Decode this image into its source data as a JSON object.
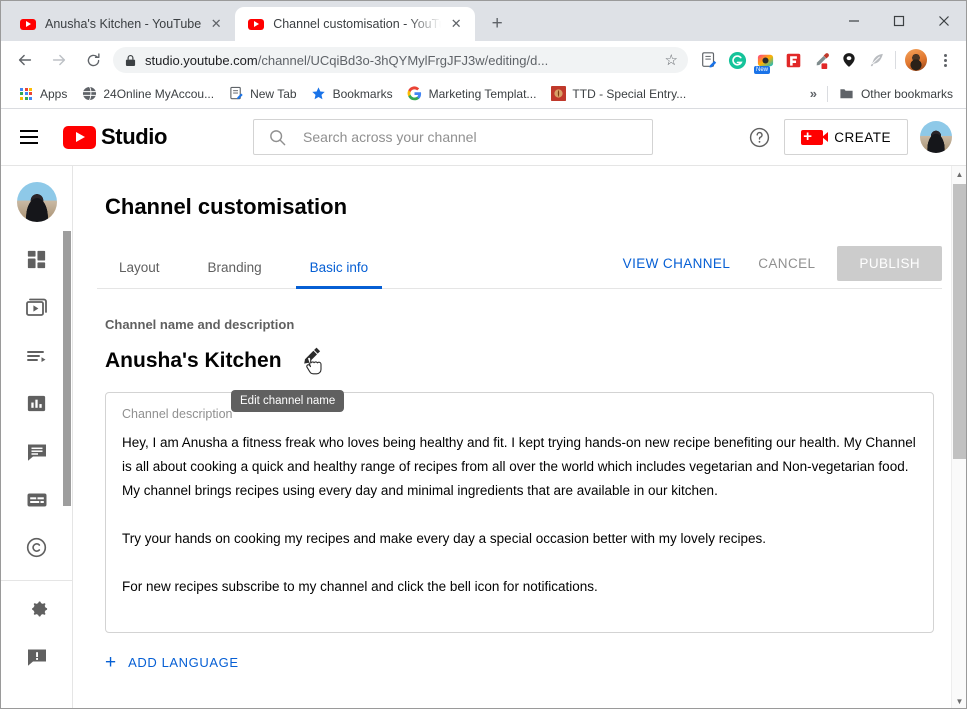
{
  "browser": {
    "tabs": [
      {
        "title": "Anusha's Kitchen - YouTube",
        "favicon": "youtube-icon",
        "active": false
      },
      {
        "title": "Channel customisation - YouTube Studio",
        "favicon": "youtube-icon",
        "active": true
      }
    ],
    "new_tab_label": "+",
    "window_controls": {
      "minimize": "minimize-icon",
      "maximize": "maximize-icon",
      "close": "close-icon"
    },
    "nav": {
      "back": "back-arrow-icon",
      "forward": "forward-arrow-icon",
      "reload": "reload-icon"
    },
    "omnibox": {
      "lock": "lock-icon",
      "url_domain": "studio.youtube.com",
      "url_path": "/channel/UCqiBd3o-3hQYMylFrgJFJ3w/editing/d...",
      "bookmark_star": "star-icon"
    },
    "extensions": [
      {
        "name": "note-edit-extension-icon"
      },
      {
        "name": "grammarly-extension-icon"
      },
      {
        "name": "screenshot-extension-icon",
        "badge": "New"
      },
      {
        "name": "flipboard-extension-icon"
      },
      {
        "name": "eyedropper-extension-icon"
      },
      {
        "name": "location-pin-extension-icon"
      },
      {
        "name": "feather-extension-icon"
      }
    ],
    "profile_avatar": "profile-avatar",
    "menu": "kebab-menu-icon",
    "bookmarks": [
      {
        "label": "Apps",
        "icon": "apps-grid-icon"
      },
      {
        "label": "24Online MyAccou...",
        "icon": "globe-icon"
      },
      {
        "label": "New Tab",
        "icon": "note-icon"
      },
      {
        "label": "Bookmarks",
        "icon": "star-icon"
      },
      {
        "label": "Marketing Templat...",
        "icon": "google-icon"
      },
      {
        "label": "TTD - Special Entry...",
        "icon": "ttd-icon"
      }
    ],
    "bookmarks_overflow": "»",
    "other_bookmarks": {
      "label": "Other bookmarks",
      "icon": "folder-icon"
    }
  },
  "studio": {
    "menu_icon": "hamburger-menu-icon",
    "logo_label": "Studio",
    "logo_icon": "youtube-logo-icon",
    "search": {
      "placeholder": "Search across your channel",
      "icon": "search-icon",
      "value": ""
    },
    "help_icon": "help-circle-icon",
    "create_button": {
      "label": "CREATE",
      "icon": "video-camera-plus-icon"
    },
    "account_avatar": "account-avatar",
    "sidebar": {
      "avatar": "channel-avatar",
      "items": [
        {
          "name": "dashboard",
          "icon": "dashboard-icon"
        },
        {
          "name": "content",
          "icon": "video-library-icon"
        },
        {
          "name": "playlists",
          "icon": "playlist-icon"
        },
        {
          "name": "analytics",
          "icon": "analytics-bar-chart-icon"
        },
        {
          "name": "comments",
          "icon": "comment-icon"
        },
        {
          "name": "subtitles",
          "icon": "subtitles-icon"
        },
        {
          "name": "copyright",
          "icon": "copyright-icon"
        }
      ],
      "footer_items": [
        {
          "name": "settings",
          "icon": "gear-icon"
        },
        {
          "name": "send-feedback",
          "icon": "feedback-icon"
        }
      ]
    }
  },
  "main": {
    "page_title": "Channel customisation",
    "tabs": [
      {
        "label": "Layout",
        "active": false
      },
      {
        "label": "Branding",
        "active": false
      },
      {
        "label": "Basic info",
        "active": true
      }
    ],
    "actions": {
      "view_channel": "VIEW CHANNEL",
      "cancel": "CANCEL",
      "publish": "PUBLISH"
    },
    "section_label": "Channel name and description",
    "channel_name": "Anusha's Kitchen",
    "edit_name_icon": "edit-pencil-icon",
    "tooltip": "Edit channel name",
    "description": {
      "label": "Channel description",
      "paragraphs": [
        "Hey, I am Anusha a fitness freak who loves being healthy and fit. I kept trying hands-on new recipe benefiting our health. My Channel is all about cooking a quick and healthy range of recipes from all over the world which includes vegetarian and Non-vegetarian food. My channel brings recipes using every day and minimal ingredients that are available in our kitchen.",
        "Try your hands on cooking my recipes and make every day a special occasion better with my lovely recipes.",
        "For new recipes subscribe to my channel and click the bell icon for notifications."
      ]
    },
    "add_language": {
      "label": "ADD LANGUAGE",
      "icon": "plus-icon"
    }
  },
  "colors": {
    "accent_blue": "#065fd4",
    "youtube_red": "#ff0000",
    "publish_disabled": "#cccccc",
    "tooltip_bg": "#606060"
  }
}
